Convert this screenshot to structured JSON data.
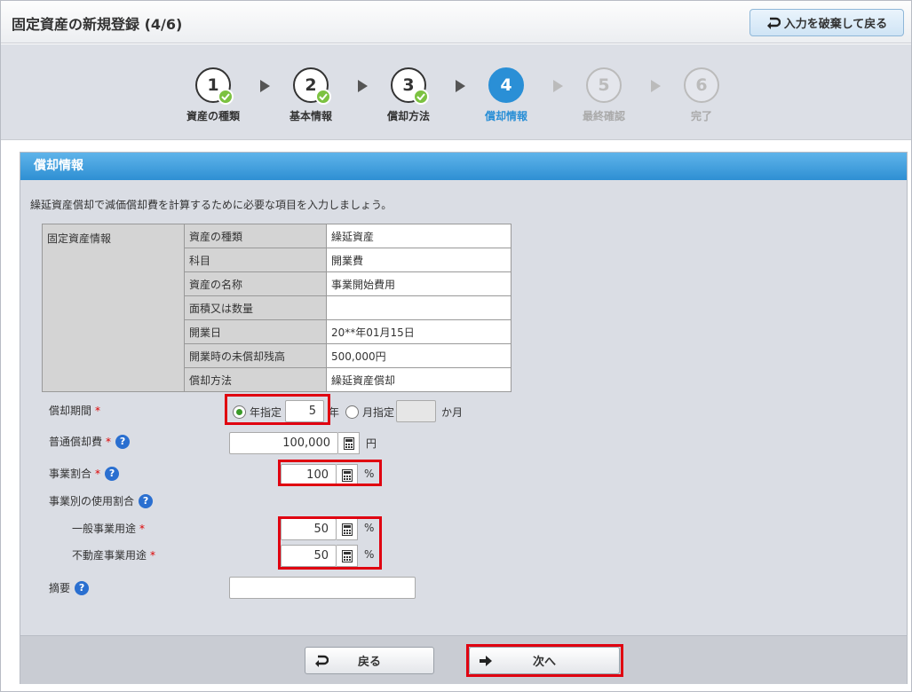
{
  "header": {
    "title": "固定資産の新規登録 (4/6)",
    "discard_label": "入力を破棄して戻る"
  },
  "steps": [
    {
      "num": "1",
      "label": "資産の種類",
      "state": "done"
    },
    {
      "num": "2",
      "label": "基本情報",
      "state": "done"
    },
    {
      "num": "3",
      "label": "償却方法",
      "state": "done"
    },
    {
      "num": "4",
      "label": "償却情報",
      "state": "active"
    },
    {
      "num": "5",
      "label": "最終確認",
      "state": "future"
    },
    {
      "num": "6",
      "label": "完了",
      "state": "future"
    }
  ],
  "panel": {
    "title": "償却情報",
    "intro": "繰延資産償却で減価償却費を計算するために必要な項目を入力しましょう。"
  },
  "info_table": {
    "group_label": "固定資産情報",
    "rows": [
      {
        "label": "資産の種類",
        "value": "繰延資産"
      },
      {
        "label": "科目",
        "value": "開業費"
      },
      {
        "label": "資産の名称",
        "value": "事業開始費用"
      },
      {
        "label": "面積又は数量",
        "value": ""
      },
      {
        "label": "開業日",
        "value": "20**年01月15日"
      },
      {
        "label": "開業時の未償却残高",
        "value": "500,000円"
      },
      {
        "label": "償却方法",
        "value": "繰延資産償却"
      }
    ]
  },
  "form": {
    "period": {
      "label": "償却期間",
      "year_option": "年指定",
      "year_value": "5",
      "year_unit": "年",
      "month_option": "月指定",
      "month_value": "",
      "month_unit": "か月"
    },
    "normal_dep": {
      "label": "普通償却費",
      "value": "100,000",
      "unit": "円"
    },
    "business_ratio": {
      "label": "事業割合",
      "value": "100",
      "unit": "%"
    },
    "usage_ratio": {
      "label": "事業別の使用割合"
    },
    "general": {
      "label": "一般事業用途",
      "value": "50",
      "unit": "%"
    },
    "realestate": {
      "label": "不動産事業用途",
      "value": "50",
      "unit": "%"
    },
    "summary": {
      "label": "摘要",
      "value": ""
    },
    "required_mark": "*",
    "help_mark": "?"
  },
  "footer": {
    "back_label": "戻る",
    "next_label": "次へ"
  },
  "colors": {
    "accent": "#2a8fd6",
    "done_check": "#7cc241",
    "highlight": "#e00010"
  }
}
